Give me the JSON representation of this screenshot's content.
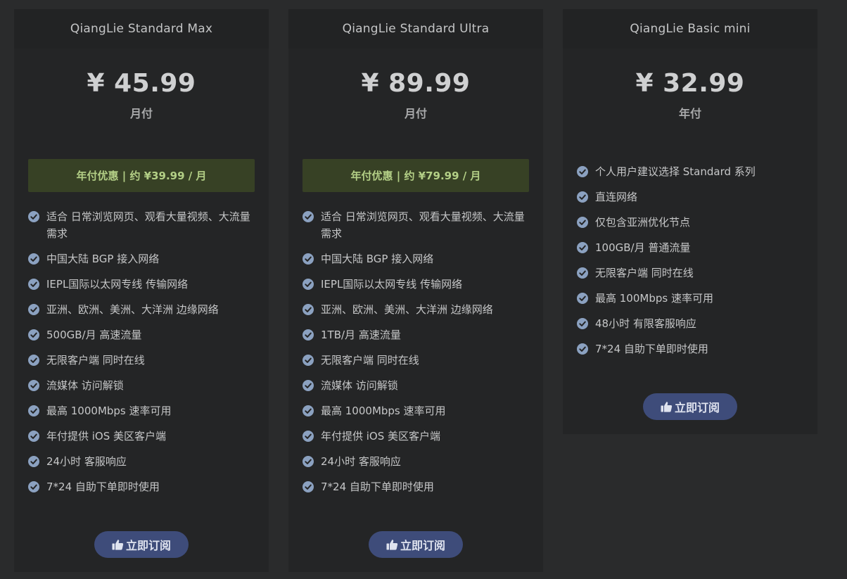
{
  "plans": [
    {
      "name": "QiangLie Standard Max",
      "price": "¥ 45.99",
      "period": "月付",
      "promo": "年付优惠 | 约 ¥39.99 / 月",
      "features": [
        "适合 日常浏览网页、观看大量视频、大流量需求",
        "中国大陆 BGP 接入网络",
        "IEPL国际以太网专线 传输网络",
        "亚洲、欧洲、美洲、大洋洲 边缘网络",
        "500GB/月 高速流量",
        "无限客户端 同时在线",
        "流媒体 访问解锁",
        "最高 1000Mbps 速率可用",
        "年付提供 iOS 美区客户端",
        "24小时 客服响应",
        "7*24 自助下单即时使用"
      ],
      "button_label": "立即订阅"
    },
    {
      "name": "QiangLie Standard Ultra",
      "price": "¥ 89.99",
      "period": "月付",
      "promo": "年付优惠 | 约 ¥79.99 / 月",
      "features": [
        "适合 日常浏览网页、观看大量视频、大流量需求",
        "中国大陆 BGP 接入网络",
        "IEPL国际以太网专线 传输网络",
        "亚洲、欧洲、美洲、大洋洲 边缘网络",
        "1TB/月 高速流量",
        "无限客户端 同时在线",
        "流媒体 访问解锁",
        "最高 1000Mbps 速率可用",
        "年付提供 iOS 美区客户端",
        "24小时 客服响应",
        "7*24 自助下单即时使用"
      ],
      "button_label": "立即订阅"
    },
    {
      "name": "QiangLie Basic mini",
      "price": "¥ 32.99",
      "period": "年付",
      "features": [
        "个人用户建议选择 Standard 系列",
        "直连网络",
        "仅包含亚洲优化节点",
        "100GB/月 普通流量",
        "无限客户端 同时在线",
        "最高 100Mbps 速率可用",
        "48小时 有限客服响应",
        "7*24 自助下单即时使用"
      ],
      "button_label": "立即订阅"
    }
  ],
  "icons": {
    "feature_check": "check-circle-icon",
    "button_icon": "thumbs-up-icon"
  },
  "colors": {
    "page_background": "#2a2b2c",
    "card_background": "#242526",
    "promo_background": "#374125",
    "promo_text": "#b3cf86",
    "check_icon": "#8ba1c0",
    "button_background": "#3e4c7a"
  }
}
